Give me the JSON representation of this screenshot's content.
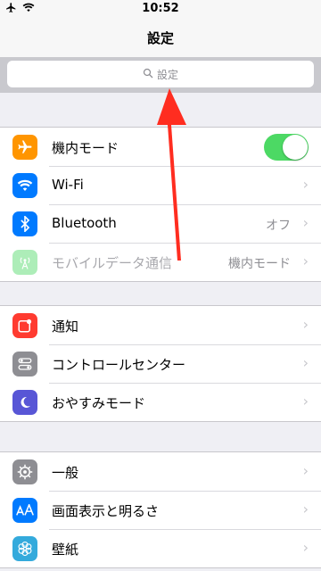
{
  "status_bar": {
    "time": "10:52",
    "icons": [
      "airplane-icon",
      "wifi-icon"
    ]
  },
  "nav": {
    "title": "設定"
  },
  "search": {
    "placeholder": "設定"
  },
  "groups": [
    [
      {
        "id": "airplane",
        "label": "機内モード",
        "icon": "airplane-icon",
        "icon_color": "#ff9500",
        "control": "toggle",
        "toggle_on": true
      },
      {
        "id": "wifi",
        "label": "Wi-Fi",
        "icon": "wifi-icon",
        "icon_color": "#007aff",
        "control": "chevron-none"
      },
      {
        "id": "bluetooth",
        "label": "Bluetooth",
        "value": "オフ",
        "icon": "bluetooth-icon",
        "icon_color": "#007aff",
        "control": "chevron"
      },
      {
        "id": "cellular",
        "label": "モバイルデータ通信",
        "value": "機内モード",
        "icon": "antenna-icon",
        "icon_color": "#4cd964",
        "control": "chevron",
        "disabled": true
      }
    ],
    [
      {
        "id": "notifications",
        "label": "通知",
        "icon": "notifications-icon",
        "icon_color": "#ff3b30",
        "control": "chevron"
      },
      {
        "id": "control-center",
        "label": "コントロールセンター",
        "icon": "control-center-icon",
        "icon_color": "#8e8e93",
        "control": "chevron"
      },
      {
        "id": "do-not-disturb",
        "label": "おやすみモード",
        "icon": "moon-icon",
        "icon_color": "#5856d6",
        "control": "chevron"
      }
    ],
    [
      {
        "id": "general",
        "label": "一般",
        "icon": "gear-icon",
        "icon_color": "#8e8e93",
        "control": "chevron"
      },
      {
        "id": "display",
        "label": "画面表示と明るさ",
        "icon": "text-size-icon",
        "icon_color": "#007aff",
        "control": "chevron"
      },
      {
        "id": "wallpaper",
        "label": "壁紙",
        "icon": "flower-icon",
        "icon_color": "#34aadc",
        "control": "chevron"
      }
    ]
  ],
  "annotation": {
    "color": "#ff2d20"
  }
}
